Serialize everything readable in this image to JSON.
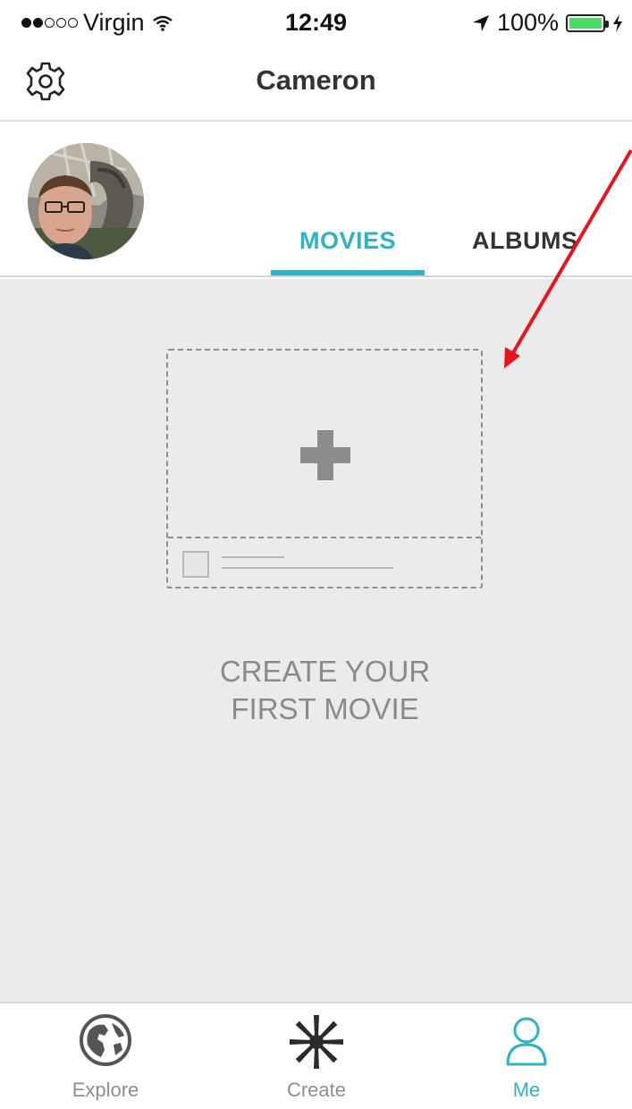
{
  "status_bar": {
    "carrier": "Virgin",
    "time": "12:49",
    "battery": "100%",
    "battery_level": 1.0
  },
  "nav": {
    "title": "Cameron",
    "settings_icon": "gear-icon"
  },
  "profile": {
    "tabs": [
      {
        "label": "MOVIES",
        "active": true
      },
      {
        "label": "ALBUMS",
        "active": false
      }
    ]
  },
  "empty_state": {
    "line1": "CREATE YOUR",
    "line2": "FIRST MOVIE",
    "icon": "plus-icon"
  },
  "tab_bar": {
    "items": [
      {
        "label": "Explore",
        "icon": "globe-icon",
        "active": false
      },
      {
        "label": "Create",
        "icon": "starburst-icon",
        "active": false
      },
      {
        "label": "Me",
        "icon": "person-icon",
        "active": true
      }
    ]
  },
  "colors": {
    "accent": "#2eb3c5",
    "annotation_arrow": "#e8141b",
    "content_background": "#ebebeb"
  }
}
